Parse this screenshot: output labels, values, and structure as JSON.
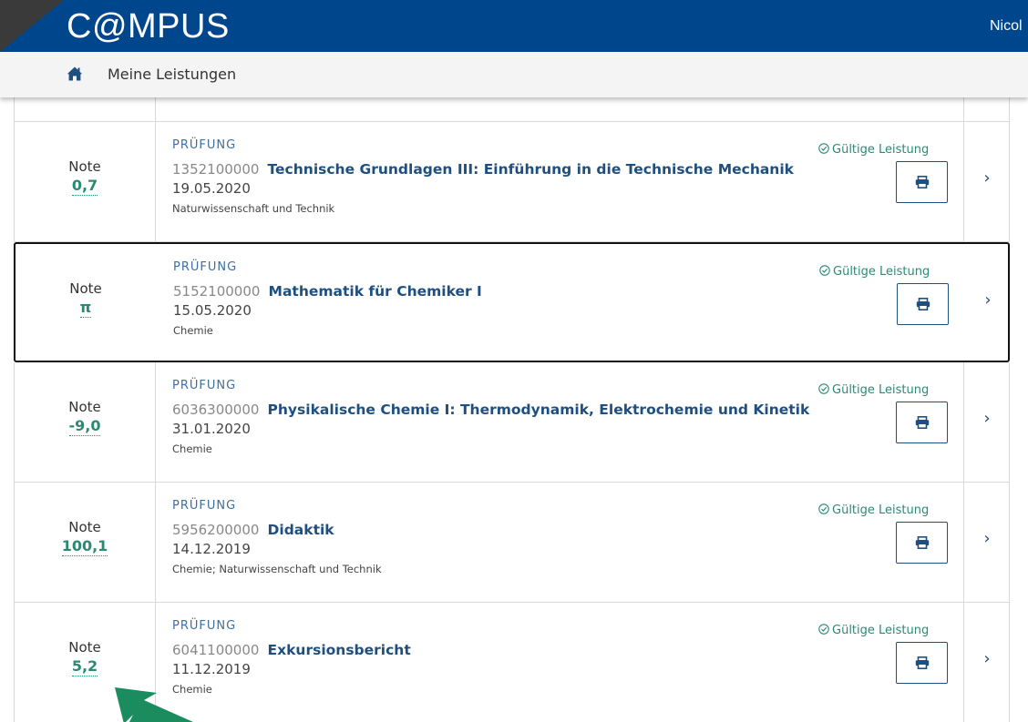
{
  "header": {
    "brand": "C@MPUS",
    "user": "Nicol"
  },
  "breadcrumb": {
    "label": "Meine Leistungen"
  },
  "colors": {
    "header_bg": "#00468c",
    "accent_green": "#2a8a74",
    "link_blue": "#1f4f7f"
  },
  "results": [
    {
      "note_label": "Note",
      "note_value": "0,7",
      "type": "PRÜFUNG",
      "code": "1352100000",
      "title": "Technische Grundlagen III: Einführung in die Technische Mechanik",
      "date": "19.05.2020",
      "category": "Naturwissenschaft und Technik",
      "status": "Gültige Leistung",
      "selected": false
    },
    {
      "note_label": "Note",
      "note_value": "π",
      "type": "PRÜFUNG",
      "code": "5152100000",
      "title": "Mathematik für Chemiker I",
      "date": "15.05.2020",
      "category": "Chemie",
      "status": "Gültige Leistung",
      "selected": true
    },
    {
      "note_label": "Note",
      "note_value": "-9,0",
      "type": "PRÜFUNG",
      "code": "6036300000",
      "title": "Physikalische Chemie I: Thermodynamik, Elektrochemie und Kinetik",
      "date": "31.01.2020",
      "category": "Chemie",
      "status": "Gültige Leistung",
      "selected": false
    },
    {
      "note_label": "Note",
      "note_value": "100,1",
      "type": "PRÜFUNG",
      "code": "5956200000",
      "title": "Didaktik",
      "date": "14.12.2019",
      "category": "Chemie; Naturwissenschaft und Technik",
      "status": "Gültige Leistung",
      "selected": false
    },
    {
      "note_label": "Note",
      "note_value": "5,2",
      "type": "PRÜFUNG",
      "code": "6041100000",
      "title": "Exkursionsbericht",
      "date": "11.12.2019",
      "category": "Chemie",
      "status": "Gültige Leistung",
      "selected": false
    }
  ],
  "icons": {
    "home": "home-icon",
    "status": "check-circle-icon",
    "print": "printer-icon",
    "details": "chevron-right-icon",
    "annotation": "green-arrow-icon"
  }
}
